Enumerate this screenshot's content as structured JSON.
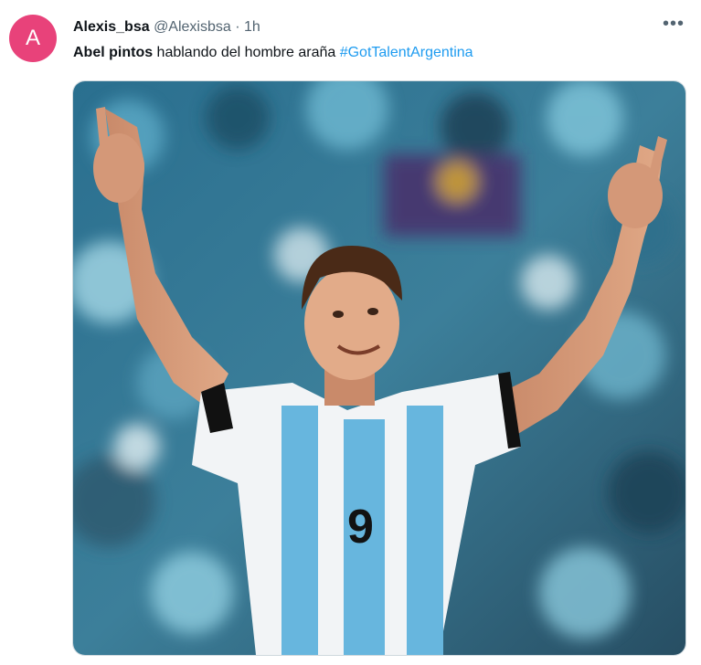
{
  "tweet": {
    "avatar_letter": "A",
    "display_name": "Alexis_bsa",
    "handle": "@Alexisbsa",
    "separator": "·",
    "time": "1h",
    "more_icon": "more-horizontal-icon",
    "text_bold": "Abel pintos",
    "text_rest": " hablando del hombre araña ",
    "hashtag": "#GotTalentArgentina",
    "media": {
      "jersey_number": "9"
    }
  },
  "colors": {
    "avatar_bg": "#e8427a",
    "hashtag": "#1d9bf0",
    "secondary_text": "#536471"
  }
}
